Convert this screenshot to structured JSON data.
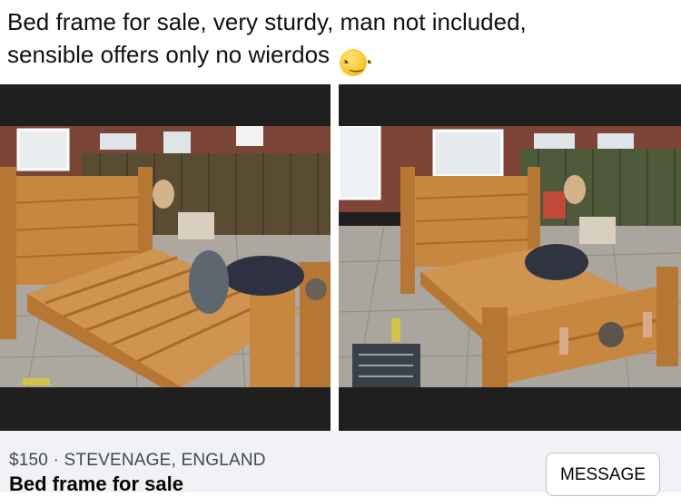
{
  "post": {
    "caption_line1": "Bed frame for sale, very sturdy, man not included,",
    "caption_line2": "sensible offers only no wierdos",
    "caption_emoji_icon": "smirking-face-emoji"
  },
  "listing": {
    "price_location": "$150 · STEVENAGE, ENGLAND",
    "title": "Bed frame for sale",
    "message_label": "MESSAGE"
  },
  "colors": {
    "wood": "#c8873f",
    "wood_dark": "#a86a2c",
    "fence": "#6b5a3c",
    "brick": "#8a4a3a",
    "patio": "#b9b4ad",
    "photo_border": "#1f1f1f"
  }
}
